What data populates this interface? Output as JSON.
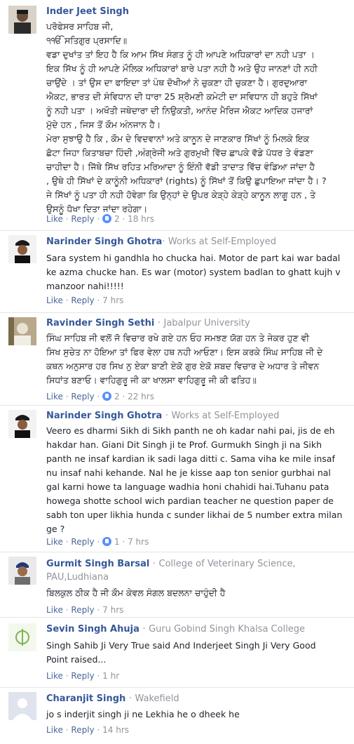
{
  "actions": {
    "like": "Like",
    "reply": "Reply",
    "dot": "·"
  },
  "comments": [
    {
      "name": "Inder Jeet Singh",
      "subtitle": "",
      "lines": [
        "ਪਰੋਫੇਸਰ ਸਾਹਿਬ ਜੀ,",
        "੧ੴ ਸਤਿਗੁਰ ਪ੍ਰਸਾਦਿ॥",
        "ਵਡਾ ਦੁਖਾਂਤ ਤਾਂ ਇਹ ਹੈ ਕਿ ਆਮ ਸਿੱਖ ਸੰਗਤ ਨੂੰ ਹੀ ਆਪਣੇ ਅਧਿਕਾਰਾਂ ਦਾ ਨਹੀ ਪਤਾ ।",
        "ਇਕ ਸਿੱਖ ਨੂੰ ਹੀ ਆਪਣੇ ਮੌਲਿਕ ਅਧਿਕਾਰਾਂ ਬਾਰੇ ਪਤਾ ਨਹੀ ਹੈ ਅਤੇ ਉਹ ਜਾਨਣਾਂ ਹੀ ਨਹੀ",
        "ਚਾਉਂਦੇ । ਤਾਂ ਉਸ ਦਾ ਫਾਇਦਾ ਤਾਂ ਪੰਥ ਦੋਖੀਆਂ ਨੇ ਚੁਕਣਾ ਹੀ ਚੁਕਣਾ ਹੈ। ਗੁਰਦੁਆਰਾ",
        "ਐਕਟ, ਭਾਰਤ ਦੀ ਸੰਵਿਧਾਨ ਦੀ ਧਾਰਾ 25 ਸ਼੍ਰੋਮਣੀ ਕਮੇਟੀ ਦਾ ਸਵਿਧਾਨ ਹੀ ਬਹੁਤੇ ਸਿੱਖਾਂ",
        "ਨੂੰ ਨਹੀ ਪਤਾ । ਅਖੌਤੀ ਜਥੇਦਾਰਾ ਦੀ ਨਿਉਕਤੀ, ਆਨੰਦ ਮੈਰਿਜ ਐਕਟ ਆਦਿਕ ਹਜਾਰਾਂ",
        "ਮੁੱਦੇ ਹਨ , ਜਿਸ ਤੋਂ ਕੌਮ ਅੰਨਜਾਨ ਹੈ।",
        "ਮੇਰਾ ਸੁਝਾਉ ਹੈ ਕਿ , ਕੌਮ ਦੇ ਵਿਦਵਾਨਾਂ ਅਤੇ ਕਾਨੂਨ ਦੇ ਜਾਣਕਾਰ ਸਿੱਖਾਂ ਨੂੰ ਮਿਲਕੇ ਇਕ",
        "ਛੋਟਾ ਜਿਹਾ ਕਿਤਾਬਚਾ ਹਿੰਦੀ ,ਅੰਗ੍ਰੇਜੀ ਅਤੇ ਗੁਰਮੁਖੀ ਵਿੱਚ ਛਾਪਕੇ ਵੱਡੇ ਪੱਧਰ ਤੇ ਵੰਡਣਾ",
        "ਚਾਹੀਦਾ ਹੈ। ਜਿੱਥੇ ਸਿੱਖ ਰਹਿਤ ਮਰਿਆਦਾ ਨੂੰ ਇੰਨੀ ਵੱਡੀ ਤਾਦਾਤ ਵਿੱਚ ਵੰਡਿਆ ਜਾਂਦਾ ਹੈ",
        ", ਉਥੇ ਹੀ ਸਿੱਖਾਂ ਦੇ ਕਾਨੂੰਨੀ ਅਧਿਕਾਰਾਂ (rights) ਨੂੰ ਸਿੱਖਾਂ ਤੋਂ ਕਿਉ ਛੁਪਾਇਆ ਜਾਂਦਾ ਹੈ। ?",
        "ਜੇ ਸਿੱਖਾਂ ਨੂੰ ਪਤਾ ਹੀ ਨਹੀ ਹੋਵੇਗਾ ਕਿ ਉਨ੍ਹਾਂ ਦੇ ਉਪਰ ਕੇੜ੍ਹੇ ਕੇੜ੍ਹੇ ਕਾਨੂਨ ਲਾਗੂ ਹਨ , ਤੇ",
        "ਉਸਨੂੰ ਧੋਖਾ ਦਿਤਾ ਜਾਂਦਾ ਰਹੇਗਾ।"
      ],
      "likes": "2",
      "time": "18 hrs"
    },
    {
      "name": "Narinder Singh Ghotra",
      "subtitle": "Works at Self-Employed",
      "lines": [
        "Sara system hi gandhla ho chucka hai. Motor de part kai war badal",
        "ke azma chucke han. Es war (motor) system badlan to ghatt kujh v",
        "manzoor nahi!!!!!"
      ],
      "likes": "",
      "time": "7 hrs"
    },
    {
      "name": "Ravinder Singh Sethi",
      "subtitle": "Jabalpur University",
      "lines": [
        "ਸਿੰਘ ਸਾਹਿਬ ਜੀ ਵਲੋਂ ਜੋ ਵਿਚਾਰ ਰਖੇ ਗਏ ਹਨ ਓਹ ਸਮਝਣ ਯੋਗ ਹਨ ਤੇ ਜੇਕਰ ਹੁਣ ਵੀ",
        "ਸਿਖ ਸੁਚੇਤ ਨਾ ਹੋਇਆ ਤਾਂ ਫਿਰ ਵੇਲਾ ਹਥ ਨਹੀ ਆਓਣਾ। ਇਸ ਕਰਕੇ ਸਿੰਘ ਸਾਹਿਬ ਜੀ ਦੇ",
        "ਕਥਨ ਅਨੁਸਾਰ ਹਰ ਸਿਖ ਨੁ ਏਕਾ ਬਾਣੀ ਏਕੋ ਗੁਰ ਏਕੋ ਸ਼ਬਦ ਵਿਚਾਰ ਦੇ ਅਧਾਰ ਤੇ ਜੀਵਨ",
        "ਸਿਧਾਂਤ ਬਣਾਓ। ਵਾਹਿਗੁਰੂ ਜੀ ਕਾ ਖਾਲਸਾ ਵਾਹਿਗੁਰੂ ਜੀ ਕੀ ਫਤਿਹ॥"
      ],
      "likes": "2",
      "time": "22 hrs"
    },
    {
      "name": "Narinder Singh Ghotra",
      "subtitle": "Works at Self-Employed",
      "lines": [
        "Veero es dharmi Sikh di Sikh panth ne oh kadar nahi pai, jis de eh",
        "hakdar han. Giani Dit Singh ji te Prof. Gurmukh Singh ji na Sikh",
        "panth ne insaf kardian ik sadi laga ditti c. Sama viha ke mile insaf",
        "nu insaf nahi kehande. Nal he je kisse aap ton senior gurbhai nal",
        "gal karni howe ta language wadhia honi chahidi hai.Tuhanu pata",
        "howega shotte school wich pardian teacher ne question paper de",
        "sabh ton uper likhia hunda c sunder likhai de 5 number extra milan",
        "ge ?"
      ],
      "likes": "1",
      "time": "7 hrs"
    },
    {
      "name": "Gurmit Singh Barsal",
      "subtitle": "College of Veterinary Science, PAU,Ludhiana",
      "lines": [
        "ਬਿਲਕੁਲ ਠੀਕ ਹੈ ਜੀ ਕੌਮ ਕੇਵਲ ਸੰਗਲ ਬਦਲਨਾ ਚਾਹੁੰਦੀ ਹੈ"
      ],
      "likes": "",
      "time": "7 hrs"
    },
    {
      "name": "Sevin Singh Ahuja",
      "subtitle": "Guru Gobind Singh Khalsa College",
      "lines": [
        "Singh Sahib Ji Very True said And Inderjeet Singh Ji Very Good",
        "Point raised..."
      ],
      "likes": "",
      "time": "1 hr"
    },
    {
      "name": "Charanjit Singh",
      "subtitle": "Wakefield",
      "lines": [
        "jo s inderjit singh ji ne Lekhia he o dheek he"
      ],
      "likes": "",
      "time": "14 hrs"
    }
  ]
}
